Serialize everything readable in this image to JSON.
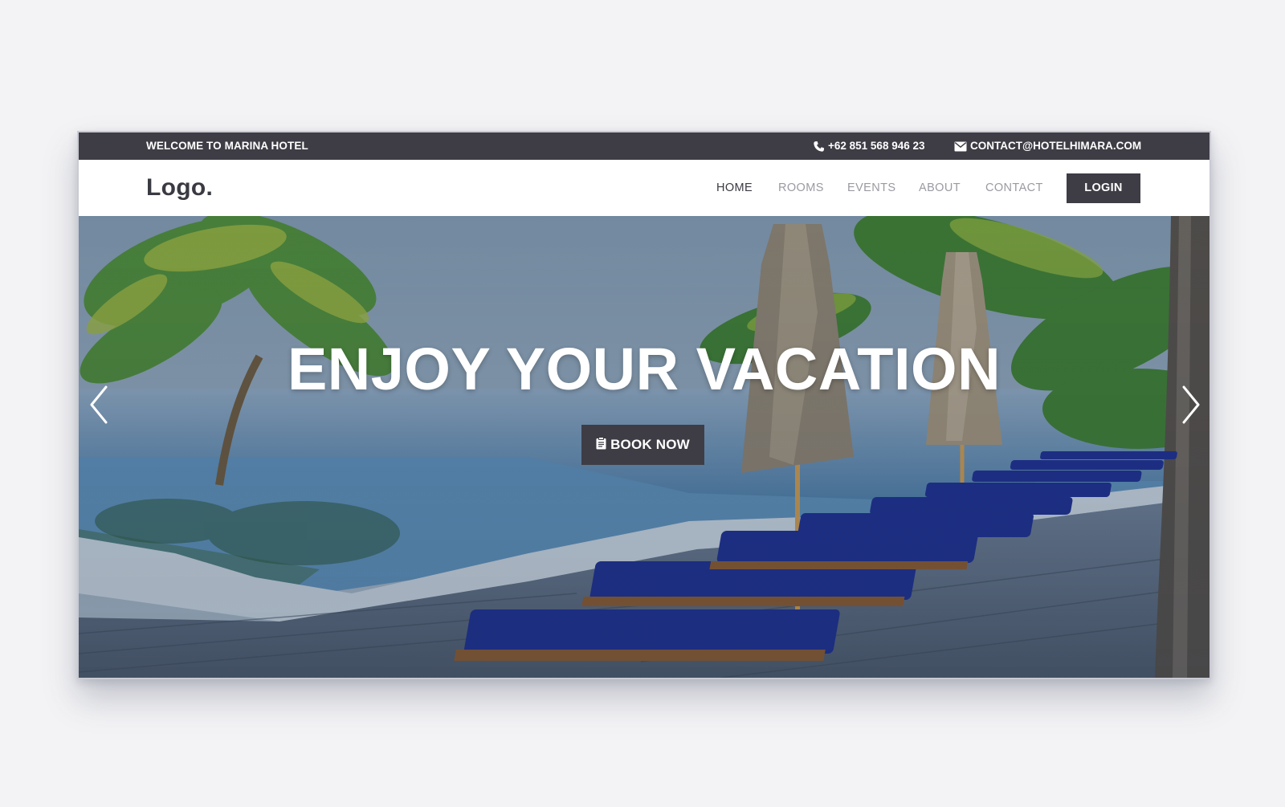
{
  "topbar": {
    "welcome": "WELCOME TO MARINA HOTEL",
    "phone": "+62 851 568 946 23",
    "email": "CONTACT@HOTELHIMARA.COM",
    "phone_icon": "phone-icon",
    "email_icon": "envelope-icon"
  },
  "nav": {
    "logo": "Logo.",
    "items": [
      {
        "label": "HOME",
        "active": true
      },
      {
        "label": "ROOMS",
        "active": false
      },
      {
        "label": "EVENTS",
        "active": false
      },
      {
        "label": "ABOUT",
        "active": false
      },
      {
        "label": "CONTACT",
        "active": false
      }
    ],
    "login_label": "LOGIN"
  },
  "hero": {
    "title": "ENJOY YOUR VACATION",
    "cta_label": "BOOK NOW",
    "cta_icon": "clipboard-icon",
    "prev_icon": "chevron-left-icon",
    "next_icon": "chevron-right-icon",
    "image_description": "resort pool deck with palm trees, umbrellas and blue sun loungers"
  },
  "colors": {
    "dark": "#3e3d45",
    "page_background": "#f3f3f5",
    "nav_muted": "#9a9aa2",
    "lounger_blue": "#1d2f8f"
  }
}
